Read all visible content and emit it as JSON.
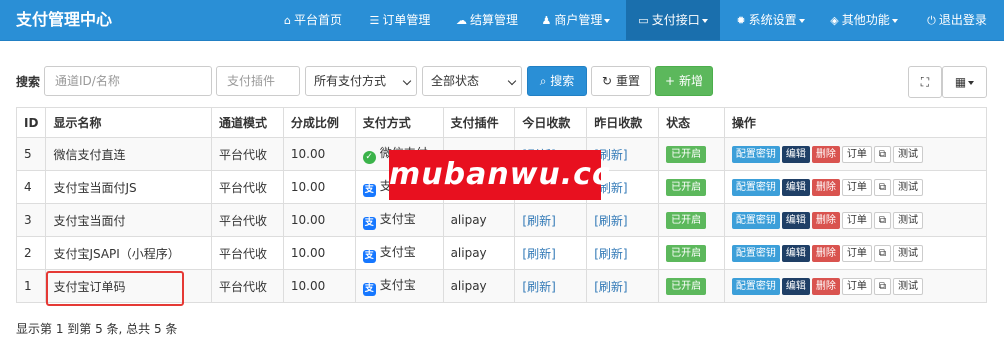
{
  "brand": "支付管理中心",
  "nav": [
    {
      "icon": "home-icon",
      "glyph": "⌂",
      "label": "平台首页",
      "dropdown": false,
      "active": false
    },
    {
      "icon": "list-icon",
      "glyph": "☰",
      "label": "订单管理",
      "dropdown": false,
      "active": false
    },
    {
      "icon": "cloud-icon",
      "glyph": "☁",
      "label": "结算管理",
      "dropdown": false,
      "active": false
    },
    {
      "icon": "user-icon",
      "glyph": "♟",
      "label": "商户管理",
      "dropdown": true,
      "active": false
    },
    {
      "icon": "credit-card-icon",
      "glyph": "▭",
      "label": "支付接口",
      "dropdown": true,
      "active": true
    },
    {
      "icon": "gear-icon",
      "glyph": "✹",
      "label": "系统设置",
      "dropdown": true,
      "active": false
    },
    {
      "icon": "cube-icon",
      "glyph": "◈",
      "label": "其他功能",
      "dropdown": true,
      "active": false
    },
    {
      "icon": "power-icon",
      "glyph": "⏻",
      "label": "退出登录",
      "dropdown": false,
      "active": false
    }
  ],
  "toolbar": {
    "search_label": "搜索",
    "channel_placeholder": "通道ID/名称",
    "plugin_placeholder": "支付插件",
    "paytype_select": "所有支付方式",
    "status_select": "全部状态",
    "search_button": "搜索",
    "reset_button": "重置",
    "add_button": "新增"
  },
  "table": {
    "headers": [
      "ID",
      "显示名称",
      "通道模式",
      "分成比例",
      "支付方式",
      "支付插件",
      "今日收款",
      "昨日收款",
      "状态",
      "操作"
    ],
    "rows": [
      {
        "id": "5",
        "name": "微信支付直连",
        "mode": "平台代收",
        "rate": "10.00",
        "paytype": "微信支付",
        "payicon": "wechat-pay-icon",
        "plugin": "wxpay",
        "today": "[刷新]",
        "yesterday": "[刷新]",
        "status": "已开启"
      },
      {
        "id": "4",
        "name": "支付宝当面付JS",
        "mode": "平台代收",
        "rate": "10.00",
        "paytype": "支付宝",
        "payicon": "alipay-icon",
        "plugin": "alipay",
        "today": "[刷新]",
        "yesterday": "[刷新]",
        "status": "已开启"
      },
      {
        "id": "3",
        "name": "支付宝当面付",
        "mode": "平台代收",
        "rate": "10.00",
        "paytype": "支付宝",
        "payicon": "alipay-icon",
        "plugin": "alipay",
        "today": "[刷新]",
        "yesterday": "[刷新]",
        "status": "已开启"
      },
      {
        "id": "2",
        "name": "支付宝JSAPI（小程序）",
        "mode": "平台代收",
        "rate": "10.00",
        "paytype": "支付宝",
        "payicon": "alipay-icon",
        "plugin": "alipay",
        "today": "[刷新]",
        "yesterday": "[刷新]",
        "status": "已开启"
      },
      {
        "id": "1",
        "name": "支付宝订单码",
        "mode": "平台代收",
        "rate": "10.00",
        "paytype": "支付宝",
        "payicon": "alipay-icon",
        "plugin": "alipay",
        "today": "[刷新]",
        "yesterday": "[刷新]",
        "status": "已开启"
      }
    ],
    "actions": {
      "config": "配置密钥",
      "edit": "编辑",
      "delete": "删除",
      "order": "订单",
      "copy_icon": "copy-icon",
      "test": "测试"
    }
  },
  "footer": "显示第 1 到第 5 条, 总共 5 条",
  "watermark": "mubanwu.cc",
  "colors": {
    "navbar": "#2a8fd6",
    "active_nav": "#1a6fad",
    "success": "#5cb85c",
    "danger": "#d9534f",
    "info": "#3c9fd9",
    "dark": "#1f3f66",
    "watermark": "#e8101f",
    "highlight": "#e53935"
  }
}
